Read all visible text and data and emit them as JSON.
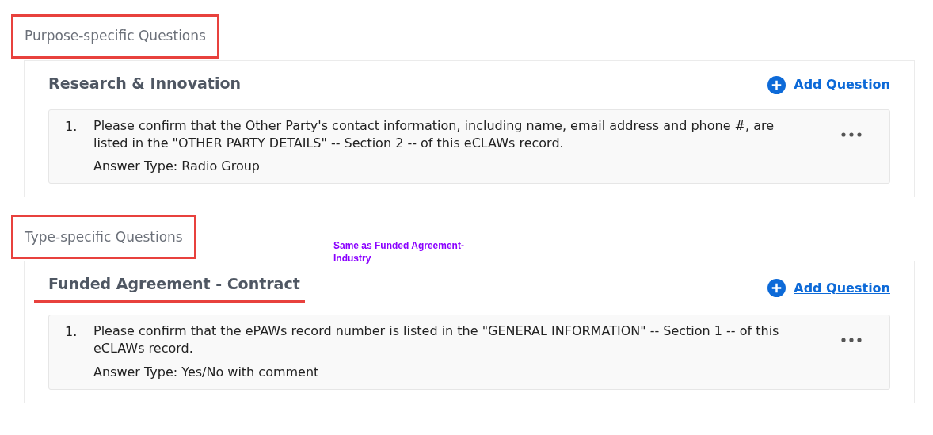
{
  "sections": [
    {
      "heading": "Purpose-specific Questions",
      "highlighted": true,
      "categories": [
        {
          "title": "Research & Innovation",
          "underlined": false,
          "add_label": "Add Question",
          "questions": [
            {
              "number": "1.",
              "text": "Please confirm that the Other Party's contact information, including name, email address and phone #, are listed in the \"OTHER PARTY DETAILS\" -- Section 2 -- of this eCLAWs record.",
              "answer_type": "Answer Type: Radio Group"
            }
          ]
        }
      ]
    },
    {
      "heading": "Type-specific Questions",
      "highlighted": true,
      "note": "Same as Funded Agreement-Industry",
      "categories": [
        {
          "title": "Funded Agreement - Contract",
          "underlined": true,
          "add_label": "Add Question",
          "questions": [
            {
              "number": "1.",
              "text": "Please confirm that the ePAWs record number is listed in the \"GENERAL INFORMATION\" -- Section 1 -- of this eCLAWs record.",
              "answer_type": "Answer Type: Yes/No with comment"
            }
          ]
        }
      ]
    }
  ]
}
